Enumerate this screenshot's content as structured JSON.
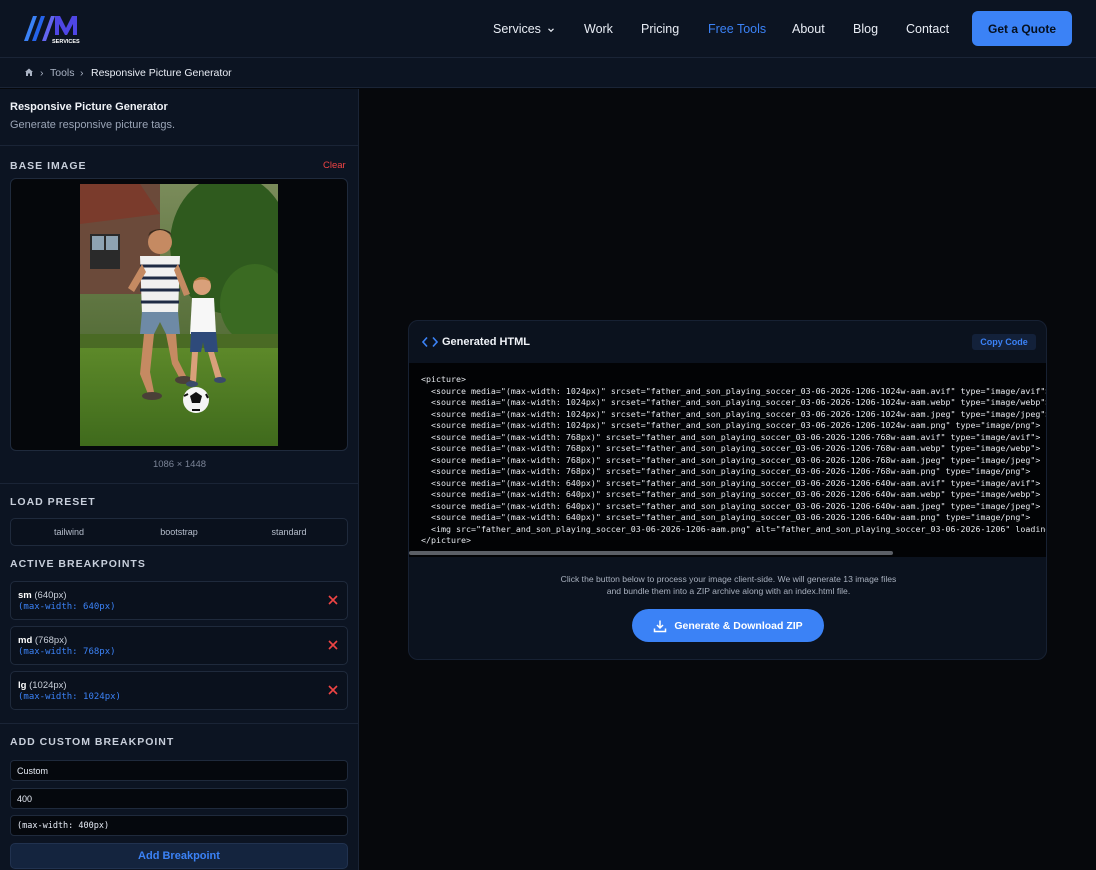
{
  "header": {
    "logo_text": "AAM SERVICES",
    "nav": {
      "services": "Services",
      "work": "Work",
      "pricing": "Pricing",
      "free_tools": "Free Tools",
      "about": "About",
      "blog": "Blog",
      "contact": "Contact"
    },
    "cta": "Get a Quote",
    "accent": "#3b82f6"
  },
  "breadcrumb": {
    "home_icon": "home-icon",
    "tools": "Tools",
    "current": "Responsive Picture Generator"
  },
  "sidebar": {
    "title": "Responsive Picture Generator",
    "subtitle": "Generate responsive picture tags.",
    "base_image": {
      "label": "BASE IMAGE",
      "clear": "Clear",
      "dimensions": "1086 × 1448"
    },
    "presets": {
      "label": "LOAD PRESET",
      "items": [
        "tailwind",
        "bootstrap",
        "standard"
      ]
    },
    "breakpoints": {
      "label": "ACTIVE BREAKPOINTS",
      "items": [
        {
          "name": "sm",
          "size": "(640px)",
          "query": "(max-width: 640px)"
        },
        {
          "name": "md",
          "size": "(768px)",
          "query": "(max-width: 768px)"
        },
        {
          "name": "lg",
          "size": "(1024px)",
          "query": "(max-width: 1024px)"
        }
      ]
    },
    "custom": {
      "label": "ADD CUSTOM BREAKPOINT",
      "name_value": "Custom",
      "width_value": "400",
      "query_value": "(max-width: 400px)",
      "button": "Add Breakpoint"
    }
  },
  "output": {
    "title": "Generated HTML",
    "copy": "Copy Code",
    "code_lines": [
      "<picture>",
      "  <source media=\"(max-width: 1024px)\" srcset=\"father_and_son_playing_soccer_03-06-2026-1206-1024w-aam.avif\" type=\"image/avif\">",
      "  <source media=\"(max-width: 1024px)\" srcset=\"father_and_son_playing_soccer_03-06-2026-1206-1024w-aam.webp\" type=\"image/webp\">",
      "  <source media=\"(max-width: 1024px)\" srcset=\"father_and_son_playing_soccer_03-06-2026-1206-1024w-aam.jpeg\" type=\"image/jpeg\">",
      "  <source media=\"(max-width: 1024px)\" srcset=\"father_and_son_playing_soccer_03-06-2026-1206-1024w-aam.png\" type=\"image/png\">",
      "  <source media=\"(max-width: 768px)\" srcset=\"father_and_son_playing_soccer_03-06-2026-1206-768w-aam.avif\" type=\"image/avif\">",
      "  <source media=\"(max-width: 768px)\" srcset=\"father_and_son_playing_soccer_03-06-2026-1206-768w-aam.webp\" type=\"image/webp\">",
      "  <source media=\"(max-width: 768px)\" srcset=\"father_and_son_playing_soccer_03-06-2026-1206-768w-aam.jpeg\" type=\"image/jpeg\">",
      "  <source media=\"(max-width: 768px)\" srcset=\"father_and_son_playing_soccer_03-06-2026-1206-768w-aam.png\" type=\"image/png\">",
      "  <source media=\"(max-width: 640px)\" srcset=\"father_and_son_playing_soccer_03-06-2026-1206-640w-aam.avif\" type=\"image/avif\">",
      "  <source media=\"(max-width: 640px)\" srcset=\"father_and_son_playing_soccer_03-06-2026-1206-640w-aam.webp\" type=\"image/webp\">",
      "  <source media=\"(max-width: 640px)\" srcset=\"father_and_son_playing_soccer_03-06-2026-1206-640w-aam.jpeg\" type=\"image/jpeg\">",
      "  <source media=\"(max-width: 640px)\" srcset=\"father_and_son_playing_soccer_03-06-2026-1206-640w-aam.png\" type=\"image/png\">",
      "  <img src=\"father_and_son_playing_soccer_03-06-2026-1206-aam.png\" alt=\"father_and_son_playing_soccer_03-06-2026-1206\" loading=\"lazy\">",
      "</picture>"
    ],
    "info_line_1": "Click the button below to process your image client-side. We will generate 13 image files",
    "info_line_2": "and bundle them into a ZIP archive along with an index.html file.",
    "generate": "Generate & Download ZIP"
  }
}
